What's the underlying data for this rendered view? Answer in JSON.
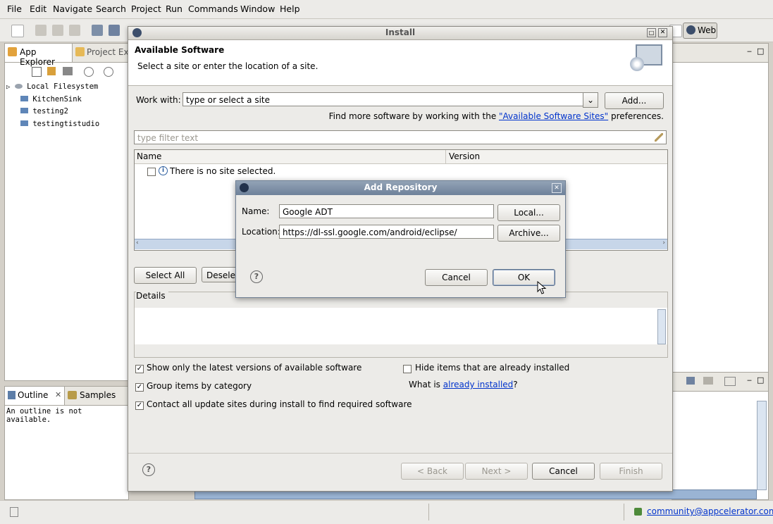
{
  "menu": [
    "File",
    "Edit",
    "Navigate",
    "Search",
    "Project",
    "Run",
    "Commands",
    "Window",
    "Help"
  ],
  "perspective": "Web",
  "left_tabs": {
    "app_explorer": "App Explorer",
    "project_explorer": "Project Exp"
  },
  "tree": [
    {
      "label": "Local Filesystem"
    },
    {
      "label": "KitchenSink"
    },
    {
      "label": "testing2"
    },
    {
      "label": "testingtistudio"
    }
  ],
  "outline": {
    "tab1": "Outline",
    "tab2": "Samples",
    "message": "An outline is not available."
  },
  "install": {
    "title": "Install",
    "header_title": "Available Software",
    "header_desc": "Select a site or enter the location of a site.",
    "work_with_label": "Work with:",
    "work_with_value": "type or select a site",
    "add_button": "Add...",
    "find_more_prefix": "Find more software by working with the ",
    "find_more_link": "\"Available Software Sites\"",
    "find_more_suffix": " preferences.",
    "filter_placeholder": "type filter text",
    "col_name": "Name",
    "col_version": "Version",
    "no_site": "There is no site selected.",
    "select_all": "Select All",
    "deselect": "Desele",
    "details": "Details",
    "opt1": "Show only the latest versions of available software",
    "opt2": "Group items by category",
    "opt3": "Contact all update sites during install to find required software",
    "opt4": "Hide items that are already installed",
    "what_is_prefix": "What is ",
    "what_is_link": "already installed",
    "what_is_suffix": "?",
    "back": "< Back",
    "next": "Next >",
    "cancel": "Cancel",
    "finish": "Finish"
  },
  "addrepo": {
    "title": "Add Repository",
    "name_label": "Name:",
    "name_value": "Google ADT",
    "location_label": "Location:",
    "location_value": "https://dl-ssl.google.com/android/eclipse/",
    "local_button": "Local...",
    "archive_button": "Archive...",
    "cancel_button": "Cancel",
    "ok_button": "OK"
  },
  "status": {
    "user": "community@appcelerator.com"
  }
}
